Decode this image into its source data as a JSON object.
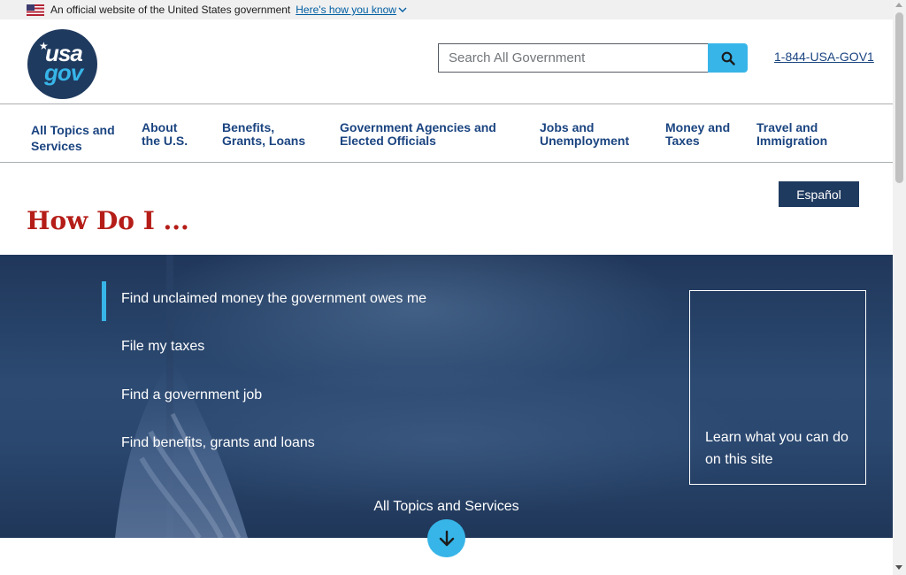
{
  "banner": {
    "official_text": "An official website of the United States government",
    "how_know_link": "Here's how you know"
  },
  "header": {
    "logo": {
      "top": "usa",
      "bottom": "gov"
    },
    "search_placeholder": "Search All Government",
    "phone": "1-844-USA-GOV1"
  },
  "nav": {
    "items": [
      {
        "line1": "All Topics and",
        "line2": "Services"
      },
      {
        "line1": "About",
        "line2": "the U.S."
      },
      {
        "line1": "Benefits,",
        "line2": "Grants, Loans"
      },
      {
        "line1": "Government Agencies and",
        "line2": "Elected Officials"
      },
      {
        "line1": "Jobs and",
        "line2": "Unemployment"
      },
      {
        "line1": "Money and",
        "line2": "Taxes"
      },
      {
        "line1": "Travel and",
        "line2": "Immigration"
      }
    ]
  },
  "language_button": "Español",
  "page_title": "How Do I ...",
  "hero": {
    "items": [
      "Find unclaimed money the government owes me",
      "File my taxes",
      "Find a government job",
      "Find benefits, grants and loans"
    ],
    "learn_box_text": "Learn what you can do on this site",
    "all_topics_label": "All Topics and Services"
  },
  "colors": {
    "brand_navy": "#1f3a5f",
    "accent_cyan": "#37b5e8",
    "title_red": "#b51d18",
    "link_blue": "#1a4480"
  },
  "icons": [
    "us-flag-icon",
    "chevron-down-icon",
    "search-icon",
    "arrow-down-icon"
  ]
}
